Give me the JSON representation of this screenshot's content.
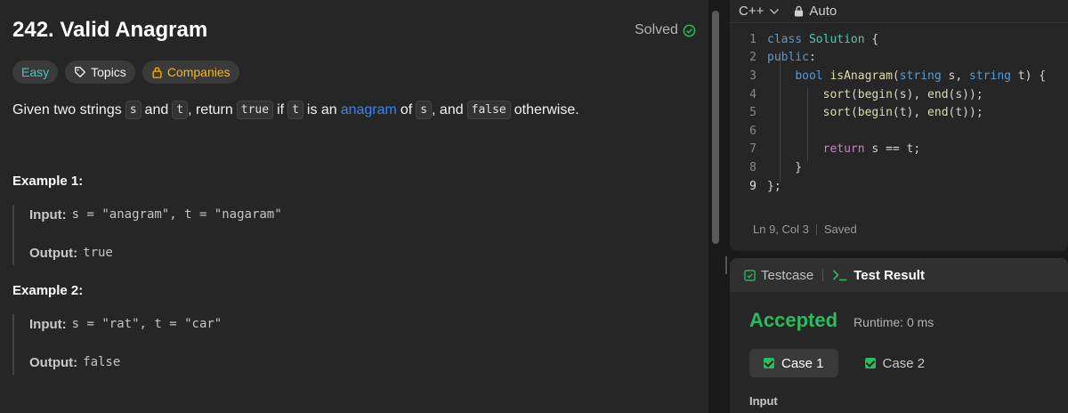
{
  "problem": {
    "title": "242. Valid Anagram",
    "solved_label": "Solved",
    "tags": {
      "difficulty": "Easy",
      "topics": "Topics",
      "companies": "Companies"
    },
    "description": {
      "p1": "Given two strings",
      "s": "s",
      "and1": "and",
      "t": "t",
      "p2": ", return",
      "true": "true",
      "if": "if",
      "t2": "t",
      "is_an": "is an",
      "anagram": "anagram",
      "of": "of",
      "s2": "s",
      "and2": ", and",
      "false": "false",
      "otherwise": "otherwise."
    },
    "examples": [
      {
        "title": "Example 1:",
        "input_label": "Input:",
        "input": "s = \"anagram\", t = \"nagaram\"",
        "output_label": "Output:",
        "output": "true"
      },
      {
        "title": "Example 2:",
        "input_label": "Input:",
        "input": "s = \"rat\", t = \"car\"",
        "output_label": "Output:",
        "output": "false"
      }
    ]
  },
  "editor": {
    "language": "C++",
    "mode": "Auto",
    "lines": [
      "1",
      "2",
      "3",
      "4",
      "5",
      "6",
      "7",
      "8",
      "9"
    ],
    "status_position": "Ln 9, Col 3",
    "status_saved": "Saved"
  },
  "results": {
    "tab_testcase": "Testcase",
    "tab_result": "Test Result",
    "verdict": "Accepted",
    "runtime": "Runtime: 0 ms",
    "cases": [
      "Case 1",
      "Case 2"
    ],
    "input_label": "Input"
  },
  "colors": {
    "easy": "#46c6c2",
    "companies": "#ffb800",
    "accepted": "#2cbb5d",
    "link": "#3b82f6"
  }
}
